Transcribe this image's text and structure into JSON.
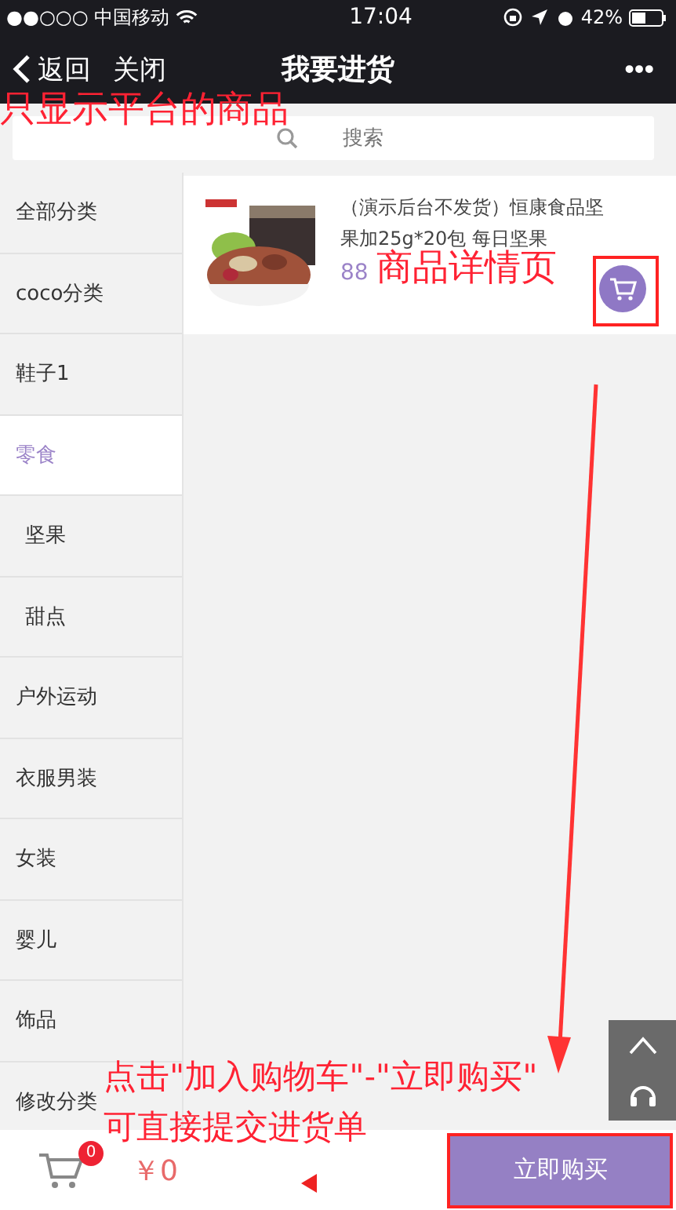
{
  "status_bar": {
    "carrier": "●●○○○ 中国移动",
    "time": "17:04",
    "battery": "42%"
  },
  "nav": {
    "back": "返回",
    "close": "关闭",
    "title": "我要进货",
    "more": "•••"
  },
  "search": {
    "placeholder": "搜索"
  },
  "sidebar": {
    "items": [
      {
        "label": "全部分类",
        "selected": false
      },
      {
        "label": "coco分类",
        "selected": false
      },
      {
        "label": "鞋子1",
        "selected": false
      },
      {
        "label": "零食",
        "selected": true,
        "children": [
          {
            "label": "坚果",
            "selected": false
          },
          {
            "label": "甜点",
            "selected": false
          }
        ]
      },
      {
        "label": "户外运动",
        "selected": false
      },
      {
        "label": "衣服男装",
        "selected": false
      },
      {
        "label": "女装",
        "selected": false
      },
      {
        "label": "婴儿",
        "selected": false
      },
      {
        "label": "饰品",
        "selected": false
      },
      {
        "label": "修改分类",
        "selected": false
      }
    ]
  },
  "products": [
    {
      "kind": "picture",
      "title": "（演示后台不发货）恒康食品坚果加25g*20包 每日坚果",
      "price": "88"
    }
  ],
  "cart": {
    "count": "0",
    "total": "￥0",
    "buy": "立即购买"
  },
  "annotations": {
    "top": "只显示平台的商品",
    "card": "商品详情页",
    "bottom_lines": [
      "点击\"加入购物车\"-\"立即购买\"",
      "可直接提交进货单"
    ]
  }
}
